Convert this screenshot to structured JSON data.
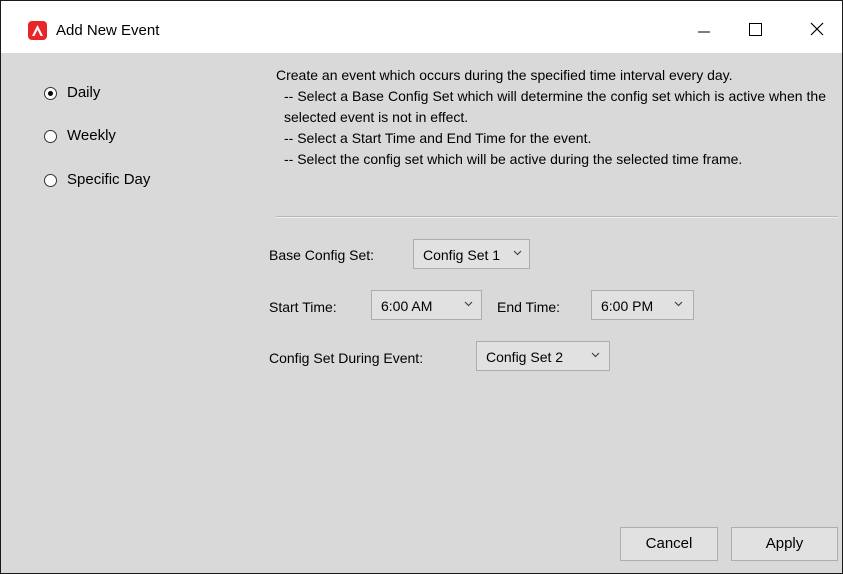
{
  "window": {
    "title": "Add New Event",
    "icon": "app-logo-icon",
    "controls": [
      "minimize-icon",
      "maximize-icon",
      "close-icon"
    ]
  },
  "frequency": {
    "options": [
      {
        "label": "Daily",
        "selected": true
      },
      {
        "label": "Weekly",
        "selected": false
      },
      {
        "label": "Specific Day",
        "selected": false
      }
    ]
  },
  "description": {
    "intro": "Create an event which occurs during the specified time interval every day.",
    "steps": [
      "-- Select a Base Config Set which will determine the config set which is active when the selected event is not in effect.",
      "-- Select a Start Time and End Time for the event.",
      "-- Select the config set which will be active during the selected time frame."
    ]
  },
  "form": {
    "base_config_label": "Base Config Set:",
    "base_config_value": "Config Set 1",
    "start_time_label": "Start Time:",
    "start_time_value": "6:00 AM",
    "end_time_label": "End Time:",
    "end_time_value": "6:00 PM",
    "during_label": "Config Set During Event:",
    "during_value": "Config Set 2"
  },
  "buttons": {
    "cancel": "Cancel",
    "apply": "Apply"
  },
  "colors": {
    "accent": "#e8262a",
    "panel": "#d9d9d9",
    "control": "#e1e1e1"
  }
}
